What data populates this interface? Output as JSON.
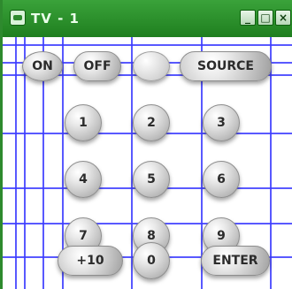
{
  "window": {
    "title": "TV - 1",
    "controls": {
      "minimize": "_",
      "maximize": "□",
      "close": "×"
    }
  },
  "remote": {
    "top_row": {
      "on": "ON",
      "off": "OFF",
      "blank": "",
      "source": "SOURCE"
    },
    "digits": [
      "1",
      "2",
      "3",
      "4",
      "5",
      "6",
      "7",
      "8",
      "9"
    ],
    "bottom_row": {
      "plus10": "+10",
      "zero": "0",
      "enter": "ENTER"
    }
  },
  "colors": {
    "titlebar_green": "#2e8a2e",
    "grid_blue": "#3c3cff",
    "button_gray": "#c7c7c7"
  }
}
